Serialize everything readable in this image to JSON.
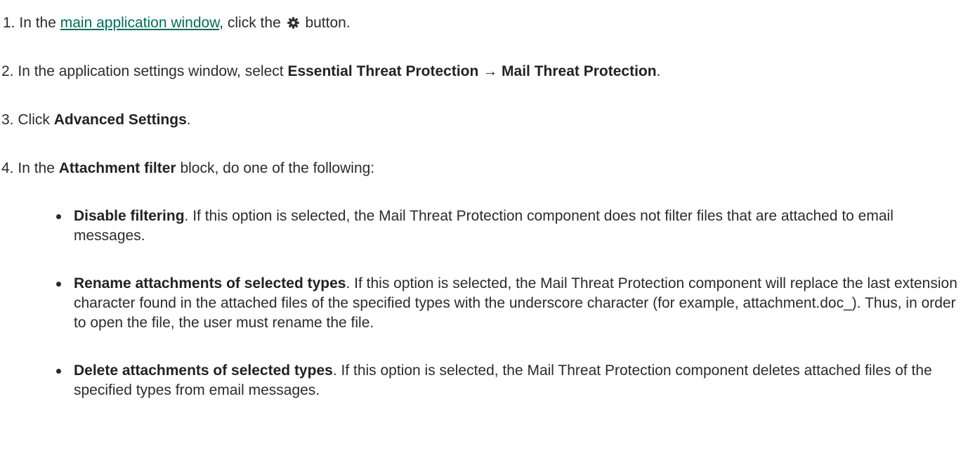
{
  "steps": [
    {
      "number": "1.",
      "text_before": "In the",
      "link_text": "main application window",
      "text_mid": ", click the",
      "icon": "gear-icon",
      "text_after": "button."
    },
    {
      "number": "2.",
      "text_before": "In the application settings window, select",
      "bold_1": "Essential Threat Protection",
      "arrow": "→",
      "bold_2": "Mail Threat Protection",
      "text_after": "."
    },
    {
      "number": "3.",
      "text_before": "Click",
      "bold": "Advanced Settings",
      "text_after": "."
    },
    {
      "number": "4.",
      "text_before": "In the",
      "bold": "Attachment filter",
      "text_after": "block, do one of the following:"
    }
  ],
  "options": [
    {
      "title": "Disable filtering",
      "description": ". If this option is selected, the Mail Threat Protection component does not filter files that are attached to email messages."
    },
    {
      "title": "Rename attachments of selected types",
      "description": ". If this option is selected, the Mail Threat Protection component will replace the last extension character found in the attached files of the specified types with the underscore character (for example, attachment.doc_). Thus, in order to open the file, the user must rename the file."
    },
    {
      "title": "Delete attachments of selected types",
      "description": ". If this option is selected, the Mail Threat Protection component deletes attached files of the specified types from email messages."
    }
  ],
  "colors": {
    "link": "#006d5b",
    "text": "#2b2b2b"
  }
}
